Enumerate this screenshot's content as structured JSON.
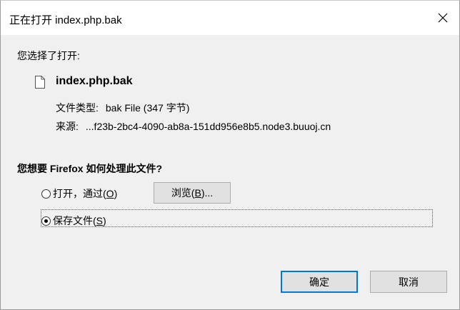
{
  "window": {
    "title": "正在打开 index.php.bak",
    "close_glyph": "✕"
  },
  "body": {
    "you_chose": "您选择了打开:",
    "file": {
      "icon": "document-icon",
      "name": "index.php.bak",
      "type_label": "文件类型:",
      "type_value": "bak File (347 字节)",
      "source_label": "来源:",
      "source_value": "...f23b-2bc4-4090-ab8a-151dd956e8b5.node3.buuoj.cn"
    },
    "question": "您想要 Firefox 如何处理此文件?"
  },
  "options": {
    "open_with": {
      "label_prefix": "打开，通过(",
      "accel": "O",
      "label_suffix": ")",
      "selected": false
    },
    "browse_button": {
      "prefix": "浏览(",
      "accel": "B",
      "suffix": ")..."
    },
    "save_file": {
      "label_prefix": "保存文件(",
      "accel": "S",
      "label_suffix": ")",
      "selected": true
    }
  },
  "buttons": {
    "ok": "确定",
    "cancel": "取消"
  },
  "colors": {
    "dialog_bg": "#f0f0f0",
    "button_bg": "#e1e1e1",
    "focus_border": "#0078d7"
  }
}
